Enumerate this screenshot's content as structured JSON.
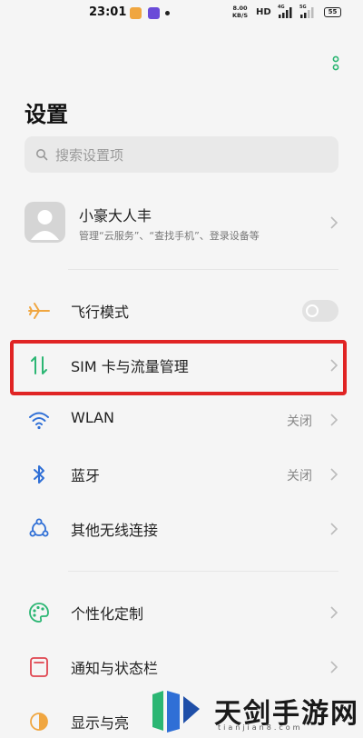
{
  "status_bar": {
    "time": "23:01",
    "net_speed_value": "8.00",
    "net_speed_unit": "KB/S",
    "hd_label": "HD",
    "signal1_label": "4G",
    "signal2_label": "5G",
    "battery_level": "55"
  },
  "page": {
    "title": "设置"
  },
  "search": {
    "placeholder": "搜索设置项"
  },
  "account": {
    "name": "小豪大人丰",
    "description": "管理“云服务”、“查找手机”、登录设备等"
  },
  "settings": [
    {
      "label": "飞行模式",
      "icon": "airplane-icon",
      "control": "toggle",
      "toggle_on": false
    },
    {
      "label": "SIM 卡与流量管理",
      "icon": "sim-data-icon",
      "highlighted": true
    },
    {
      "label": "WLAN",
      "icon": "wifi-icon",
      "value": "关闭"
    },
    {
      "label": "蓝牙",
      "icon": "bluetooth-icon",
      "value": "关闭"
    },
    {
      "label": "其他无线连接",
      "icon": "wireless-connections-icon"
    },
    {
      "label": "个性化定制",
      "icon": "palette-icon"
    },
    {
      "label": "通知与状态栏",
      "icon": "notification-icon"
    },
    {
      "label": "显示与亮",
      "icon": "brightness-icon"
    }
  ],
  "colors": {
    "accent_green": "#2bb673",
    "highlight_red": "#e02424",
    "icon_orange": "#f0a640",
    "icon_blue": "#2f6fd6"
  },
  "watermark": {
    "title": "天剑手游网",
    "subtitle": "tianjian8.com"
  }
}
